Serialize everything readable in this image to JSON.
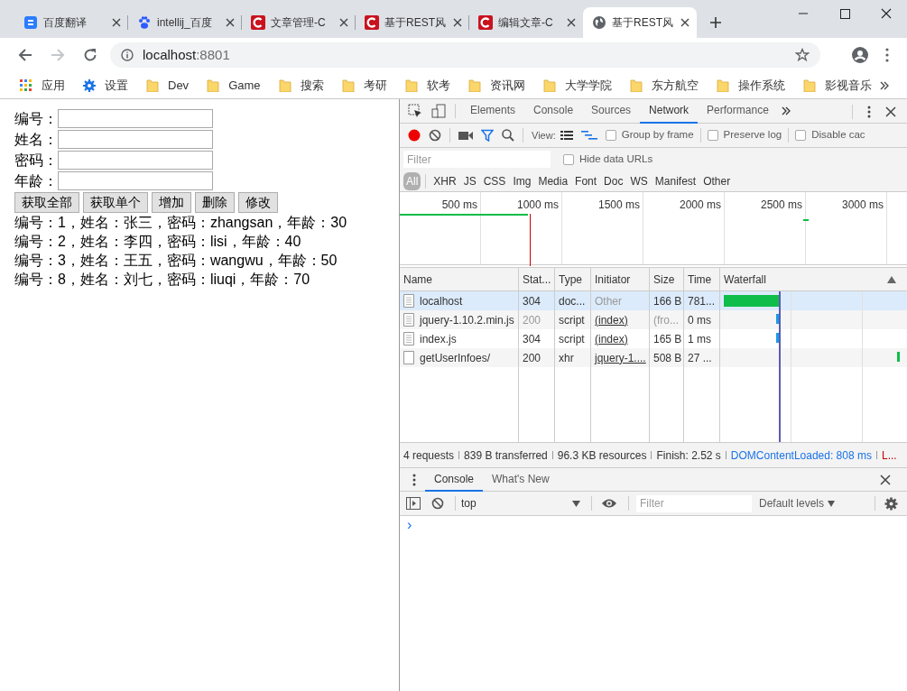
{
  "browser": {
    "tabs": [
      {
        "title": "百度翻译",
        "kind": "translate",
        "selected": false
      },
      {
        "title": "intellij_百度",
        "kind": "paw",
        "selected": false
      },
      {
        "title": "文章管理-C",
        "kind": "logo",
        "selected": false
      },
      {
        "title": "基于REST风",
        "kind": "logo",
        "selected": false
      },
      {
        "title": "编辑文章-C",
        "kind": "logo",
        "selected": false
      },
      {
        "title": "基于REST风",
        "kind": "globe",
        "selected": true
      }
    ],
    "address": {
      "host": "localhost",
      "port": ":8801"
    },
    "bookmarks": [
      {
        "label": "应用",
        "kind": "apps"
      },
      {
        "label": "设置",
        "kind": "gear"
      },
      {
        "label": "Dev",
        "kind": "folder"
      },
      {
        "label": "Game",
        "kind": "folder"
      },
      {
        "label": "搜索",
        "kind": "folder"
      },
      {
        "label": "考研",
        "kind": "folder"
      },
      {
        "label": "软考",
        "kind": "folder"
      },
      {
        "label": "资讯网",
        "kind": "folder"
      },
      {
        "label": "大学学院",
        "kind": "folder"
      },
      {
        "label": "东方航空",
        "kind": "folder"
      },
      {
        "label": "操作系统",
        "kind": "folder"
      },
      {
        "label": "影视音乐",
        "kind": "folder"
      }
    ]
  },
  "page": {
    "fields": [
      {
        "label": "编号："
      },
      {
        "label": "姓名："
      },
      {
        "label": "密码："
      },
      {
        "label": "年龄："
      }
    ],
    "buttons": [
      "获取全部",
      "获取单个",
      "增加",
      "删除",
      "修改"
    ],
    "records": [
      "编号：1，姓名：张三，密码：zhangsan，年龄：30",
      "编号：2，姓名：李四，密码：lisi，年龄：40",
      "编号：3，姓名：王五，密码：wangwu，年龄：50",
      "编号：8，姓名：刘七，密码：liuqi，年龄：70"
    ]
  },
  "devtools": {
    "panel_tabs": [
      {
        "label": "Elements",
        "selected": false
      },
      {
        "label": "Console",
        "selected": false
      },
      {
        "label": "Sources",
        "selected": false
      },
      {
        "label": "Network",
        "selected": true
      },
      {
        "label": "Performance",
        "selected": false
      }
    ],
    "view_label": "View:",
    "options": [
      {
        "label": "Group by frame",
        "checked": false
      },
      {
        "label": "Preserve log",
        "checked": false
      },
      {
        "label": "Disable cac",
        "checked": false
      }
    ],
    "filter_placeholder": "Filter",
    "hide_data_urls": {
      "label": "Hide data URLs",
      "checked": false
    },
    "type_filters": [
      {
        "label": "All",
        "selected": true
      },
      {
        "label": "XHR",
        "selected": false
      },
      {
        "label": "JS",
        "selected": false
      },
      {
        "label": "CSS",
        "selected": false
      },
      {
        "label": "Img",
        "selected": false
      },
      {
        "label": "Media",
        "selected": false
      },
      {
        "label": "Font",
        "selected": false
      },
      {
        "label": "Doc",
        "selected": false
      },
      {
        "label": "WS",
        "selected": false
      },
      {
        "label": "Manifest",
        "selected": false
      },
      {
        "label": "Other",
        "selected": false
      }
    ],
    "timeline_ticks": [
      "500 ms",
      "1000 ms",
      "1500 ms",
      "2000 ms",
      "2500 ms",
      "3000 ms"
    ],
    "columns": [
      "Name",
      "Stat...",
      "Type",
      "Initiator",
      "Size",
      "Time",
      "Waterfall"
    ],
    "rows": [
      {
        "name": "localhost",
        "status": "304",
        "type": "doc...",
        "initiator": "Other",
        "initiator_link": false,
        "size": "166 B",
        "time": "781...",
        "cached": false,
        "kind": "file",
        "selected": true
      },
      {
        "name": "jquery-1.10.2.min.js",
        "status": "200",
        "type": "script",
        "initiator": "(index)",
        "initiator_link": true,
        "size": "(fro...",
        "time": "0 ms",
        "cached": true,
        "kind": "file",
        "selected": false
      },
      {
        "name": "index.js",
        "status": "304",
        "type": "script",
        "initiator": "(index)",
        "initiator_link": true,
        "size": "165 B",
        "time": "1 ms",
        "cached": false,
        "kind": "file",
        "selected": false
      },
      {
        "name": "getUserInfoes/",
        "status": "200",
        "type": "xhr",
        "initiator": "jquery-1....",
        "initiator_link": true,
        "size": "508 B",
        "time": "27 ...",
        "cached": false,
        "kind": "request",
        "selected": false
      }
    ],
    "summary": [
      {
        "text": "4 requests",
        "color": "#333333"
      },
      {
        "text": "839 B transferred",
        "color": "#333333"
      },
      {
        "text": "96.3 KB resources",
        "color": "#333333"
      },
      {
        "text": "Finish: 2.52 s",
        "color": "#333333"
      },
      {
        "text": "DOMContentLoaded: 808 ms",
        "color": "#1a73e8"
      },
      {
        "text": "L...",
        "color": "#c80000"
      }
    ],
    "drawer_tabs": [
      {
        "label": "Console",
        "selected": true
      },
      {
        "label": "What's New",
        "selected": false
      }
    ],
    "console": {
      "context": "top",
      "filter_placeholder": "Filter",
      "levels": "Default levels",
      "prompt": "›"
    }
  }
}
